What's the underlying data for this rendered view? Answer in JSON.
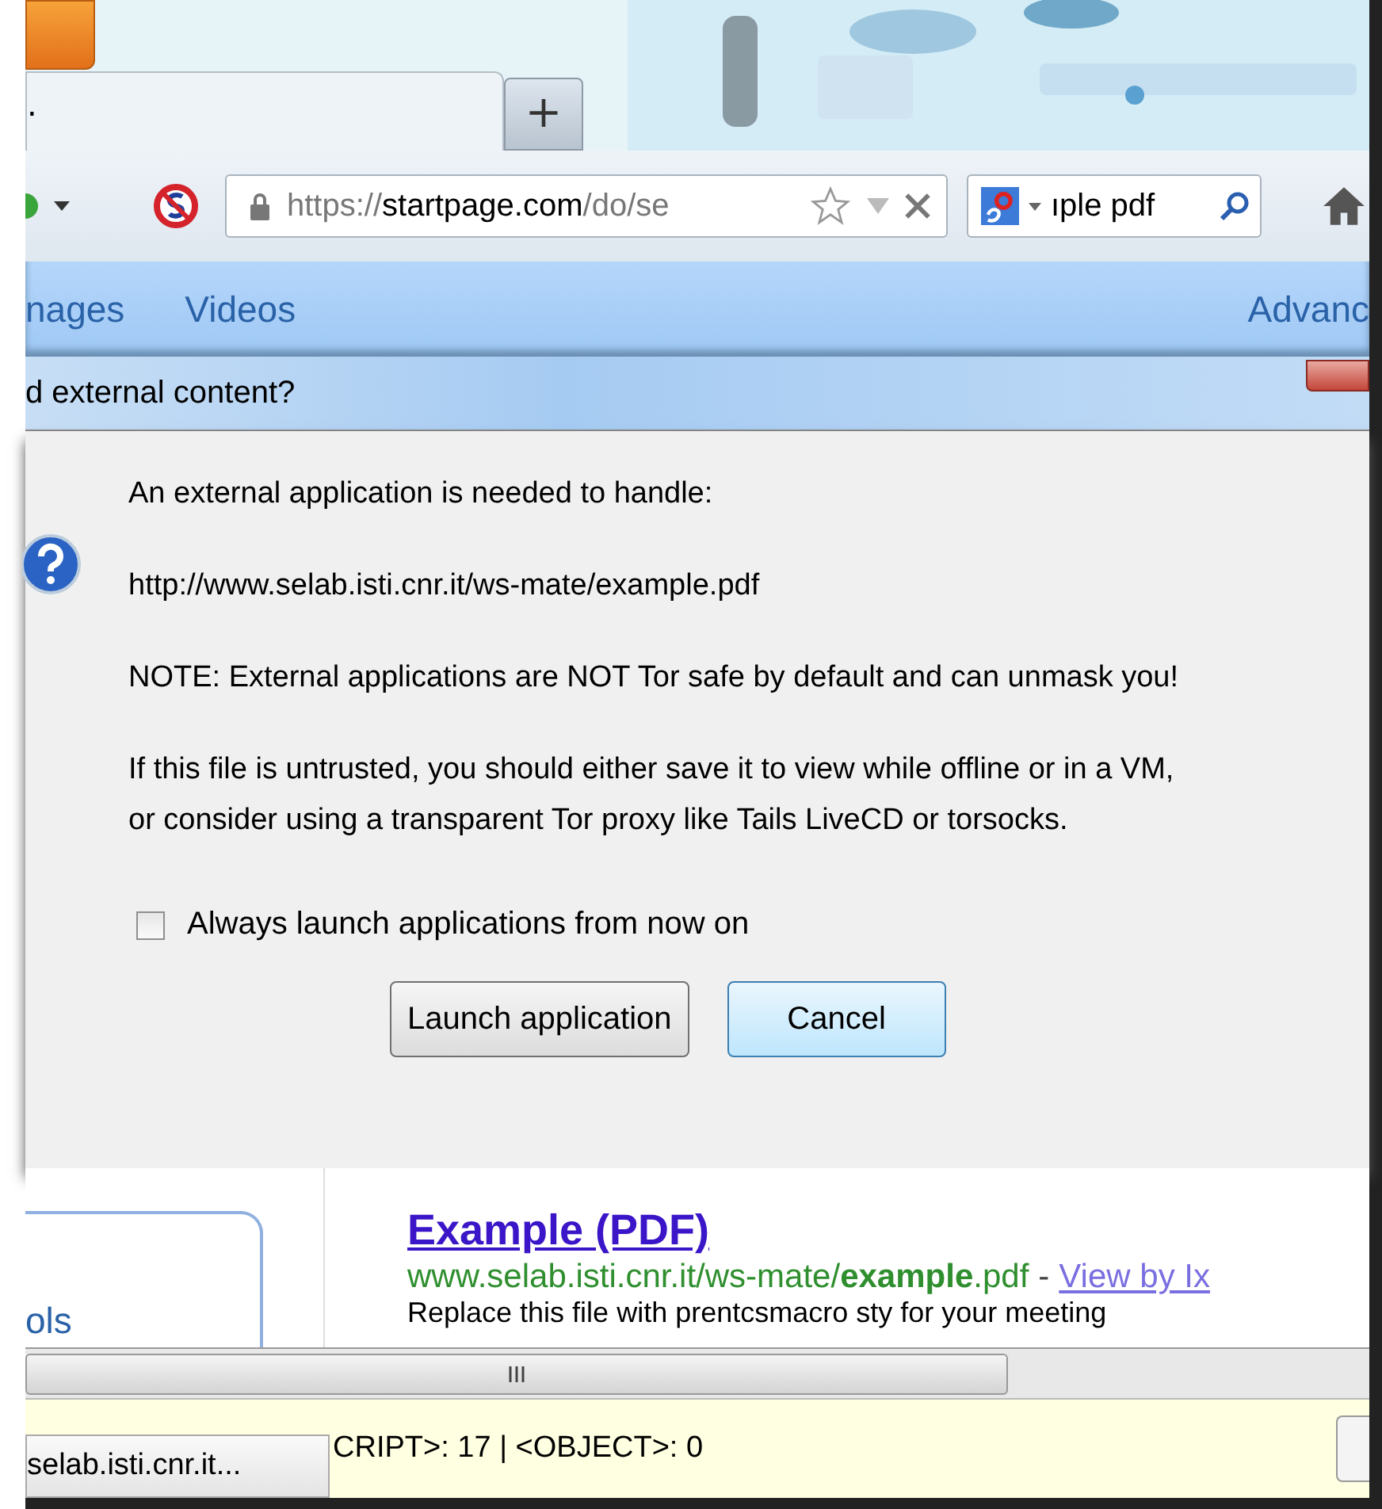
{
  "tabs": [
    {
      "label": ".",
      "selected": true
    }
  ],
  "new_tab": "+",
  "address_bar": {
    "scheme": "https://",
    "host": "startpage.com",
    "path": "/do/se",
    "secure": true
  },
  "search_field": {
    "value": "ıple pdf"
  },
  "page_menu": {
    "items": [
      "nages",
      "Videos"
    ],
    "right": "Advanc"
  },
  "dialog": {
    "title": "d external content?",
    "lines": [
      "An external application is needed to handle:",
      "http://www.selab.isti.cnr.it/ws-mate/example.pdf",
      "NOTE: External applications are NOT Tor safe by default and can unmask you!",
      "If this file is untrusted, you should either save it to view while offline or in a VM,\nor consider using a transparent Tor proxy like Tails LiveCD or torsocks."
    ],
    "checkbox": {
      "label": "Always launch applications from now on",
      "checked": false
    },
    "buttons": [
      {
        "label": "Launch application",
        "default": false
      },
      {
        "label": "Cancel",
        "default": true
      }
    ]
  },
  "sidebar": {
    "text": "ols"
  },
  "result": {
    "title": "Example (PDF)",
    "url": "www.selab.isti.cnr.it/ws-mate/**example**.pdf",
    "separator": "-",
    "link": "View by Ix",
    "snippet": "Replace this file with prentcsmacro sty for your meeting"
  },
  "status_bar": {
    "tab": "selab.isti.cnr.it...",
    "text": "CRIPT>: 17 | <OBJECT>: 0"
  }
}
